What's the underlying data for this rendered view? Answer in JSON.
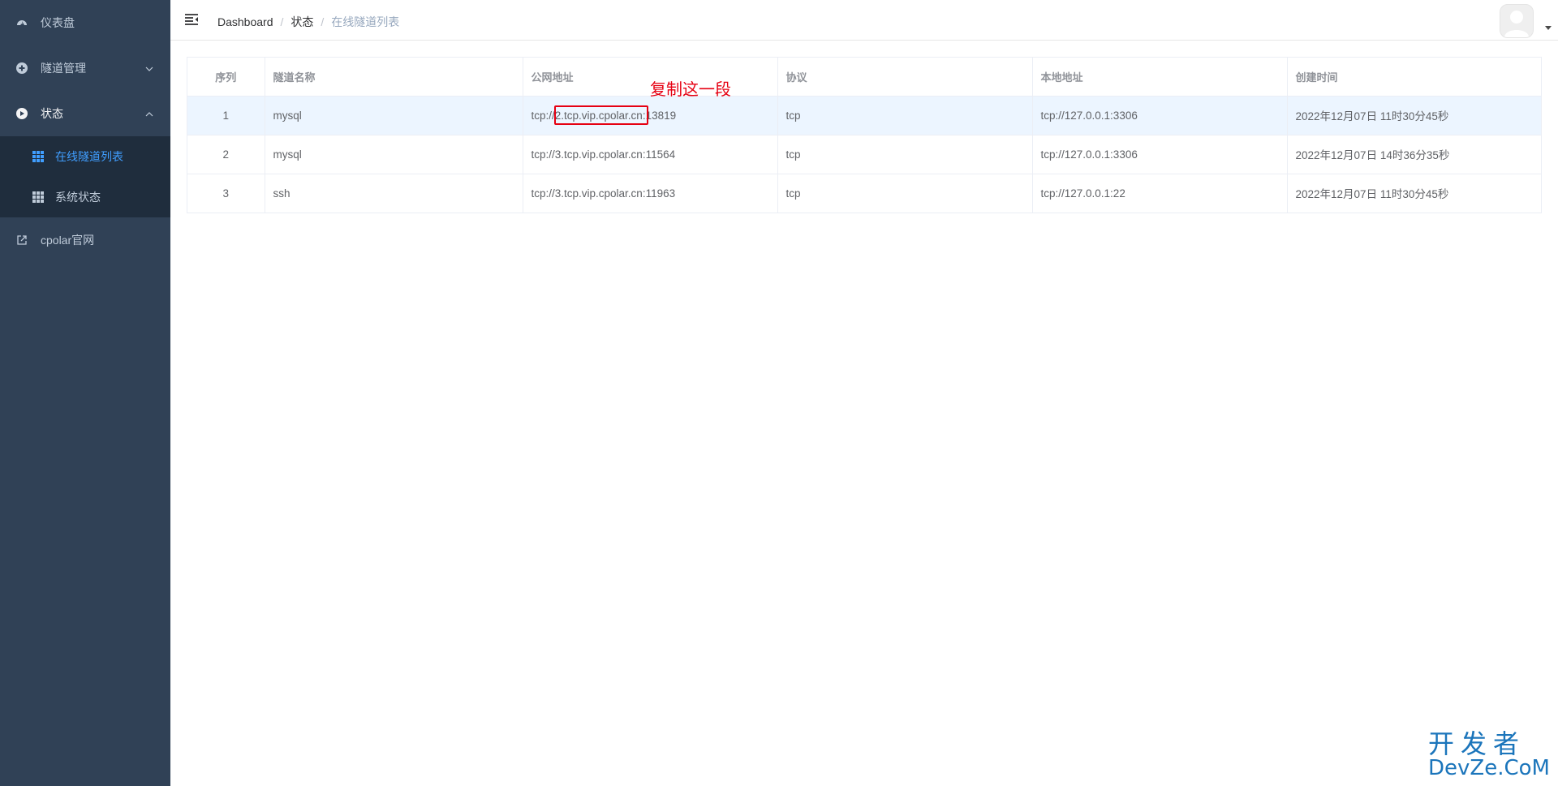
{
  "sidebar": {
    "items": [
      {
        "label": "仪表盘"
      },
      {
        "label": "隧道管理"
      },
      {
        "label": "状态"
      },
      {
        "label": "cpolar官网"
      }
    ],
    "submenu": [
      {
        "label": "在线隧道列表"
      },
      {
        "label": "系统状态"
      }
    ]
  },
  "breadcrumb": [
    "Dashboard",
    "状态",
    "在线隧道列表"
  ],
  "table": {
    "headers": [
      "序列",
      "隧道名称",
      "公网地址",
      "协议",
      "本地地址",
      "创建时间"
    ],
    "rows": [
      [
        "1",
        "mysql",
        "tcp://2.tcp.vip.cpolar.cn:13819",
        "tcp",
        "tcp://127.0.0.1:3306",
        "2022年12月07日 11时30分45秒"
      ],
      [
        "2",
        "mysql",
        "tcp://3.tcp.vip.cpolar.cn:11564",
        "tcp",
        "tcp://127.0.0.1:3306",
        "2022年12月07日 14时36分35秒"
      ],
      [
        "3",
        "ssh",
        "tcp://3.tcp.vip.cpolar.cn:11963",
        "tcp",
        "tcp://127.0.0.1:22",
        "2022年12月07日 11时30分45秒"
      ]
    ]
  },
  "annotation": {
    "text": "复制这一段"
  },
  "watermark": {
    "line1": "开发者",
    "line2": "DevZe.CoM"
  },
  "colors": {
    "sidebar": "#304156",
    "submenu": "#1f2d3d",
    "accent": "#409eff",
    "annotation": "#e60012"
  }
}
